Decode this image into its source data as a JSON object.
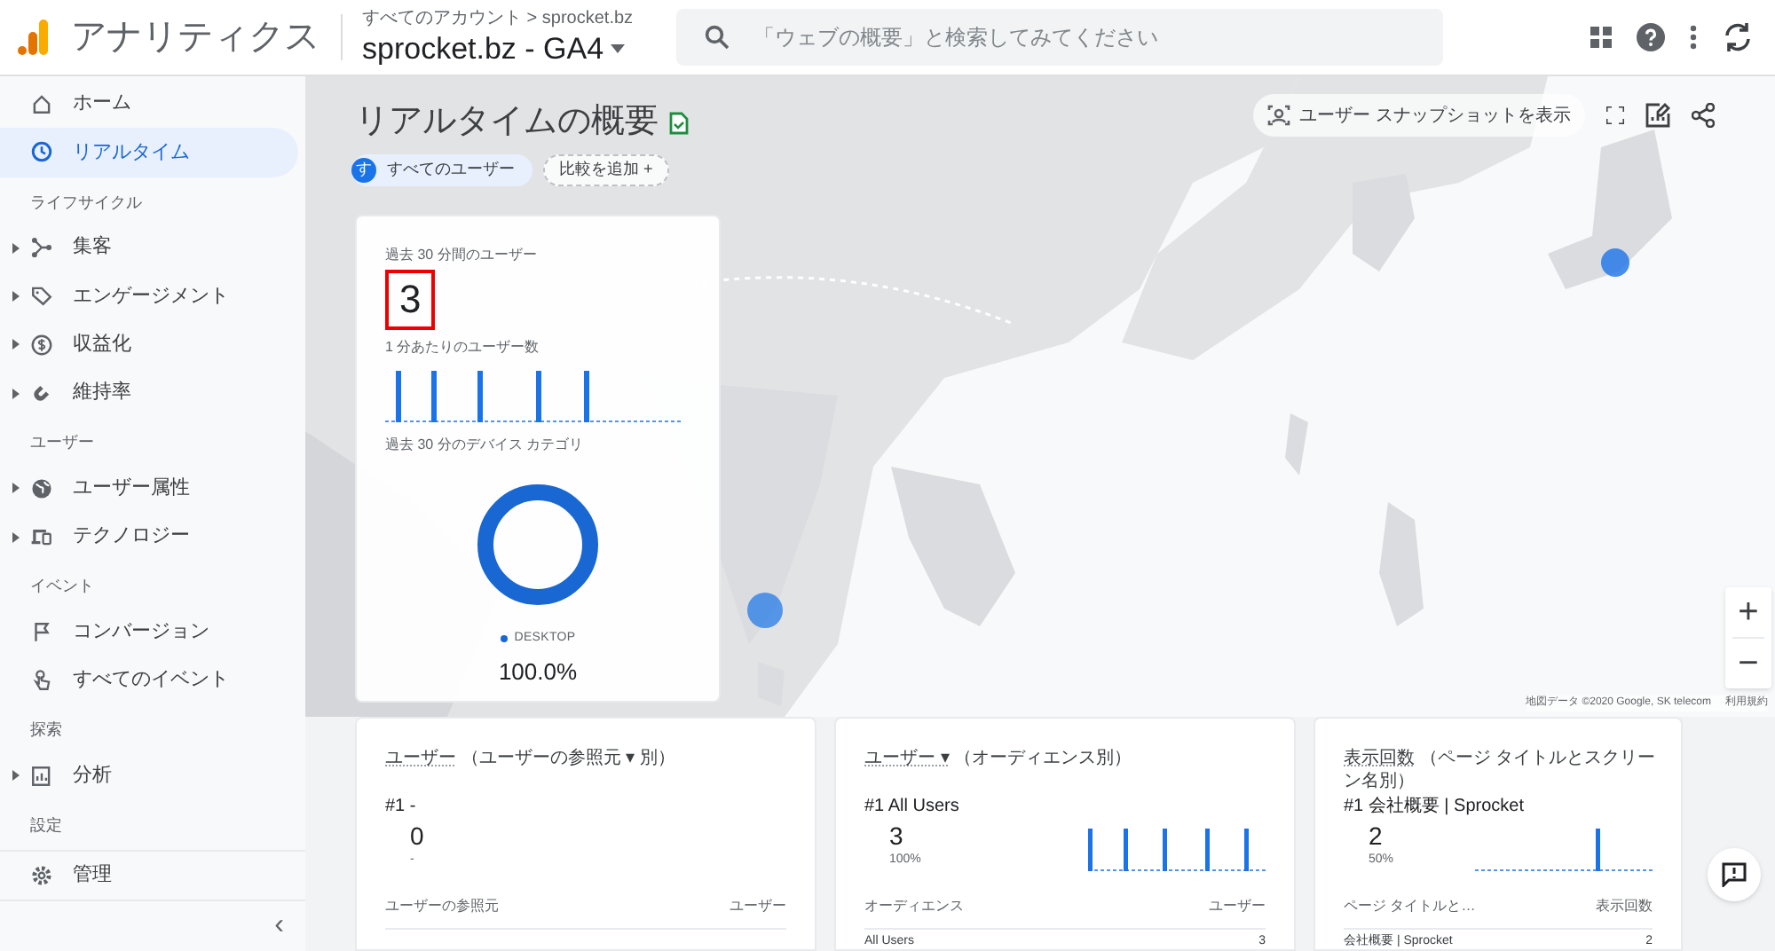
{
  "header": {
    "app_name": "アナリティクス",
    "breadcrumb": "すべてのアカウント > sprocket.bz",
    "property": "sprocket.bz - GA4",
    "search": {
      "placeholder": "「ウェブの概要」と検索してみてください"
    }
  },
  "sidebar": {
    "items": [
      {
        "kind": "item",
        "label": "ホーム",
        "selected": false,
        "expandable": false
      },
      {
        "kind": "item",
        "label": "リアルタイム",
        "selected": true,
        "expandable": false
      },
      {
        "kind": "section",
        "label": "ライフサイクル"
      },
      {
        "kind": "item",
        "label": "集客",
        "selected": false,
        "expandable": true
      },
      {
        "kind": "item",
        "label": "エンゲージメント",
        "selected": false,
        "expandable": true
      },
      {
        "kind": "item",
        "label": "収益化",
        "selected": false,
        "expandable": true
      },
      {
        "kind": "item",
        "label": "維持率",
        "selected": false,
        "expandable": true
      },
      {
        "kind": "section",
        "label": "ユーザー"
      },
      {
        "kind": "item",
        "label": "ユーザー属性",
        "selected": false,
        "expandable": true
      },
      {
        "kind": "item",
        "label": "テクノロジー",
        "selected": false,
        "expandable": true
      },
      {
        "kind": "section",
        "label": "イベント"
      },
      {
        "kind": "item",
        "label": "コンバージョン",
        "selected": false,
        "expandable": false
      },
      {
        "kind": "item",
        "label": "すべてのイベント",
        "selected": false,
        "expandable": false
      },
      {
        "kind": "section",
        "label": "探索"
      },
      {
        "kind": "item",
        "label": "分析",
        "selected": false,
        "expandable": true
      },
      {
        "kind": "section",
        "label": "設定"
      }
    ],
    "admin": {
      "label": "管理"
    },
    "collapse": "‹"
  },
  "page": {
    "title": "リアルタイムの概要",
    "segment": {
      "avatar": "す",
      "label": "すべてのユーザー"
    },
    "compare": "比較を追加 +",
    "snapshot": "ユーザー スナップショットを表示",
    "map_credit": "地図データ ©2020 Google, SK telecom",
    "map_terms": "利用規約",
    "zoom_in": "+",
    "zoom_out": "−"
  },
  "summary": {
    "users_label": "過去 30 分間のユーザー",
    "users_value": "3",
    "highlighted": true,
    "per_minute_label": "1 分あたりのユーザー数",
    "device_label": "過去 30 分のデバイス カテゴリ",
    "legend": "DESKTOP",
    "share": "100.0%"
  },
  "cards": [
    {
      "title": "ユーザー",
      "subtitle": "（ユーザーの参照元 ▾ 別）",
      "rank": "#1 -",
      "value": "0",
      "share": "-",
      "col1": "ユーザーの参照元",
      "col2": "ユーザー"
    },
    {
      "title": "ユーザー ▾",
      "subtitle": "（オーディエンス別）",
      "rank": "#1  All Users",
      "value": "3",
      "share": "100%",
      "col1": "オーディエンス",
      "col2": "ユーザー",
      "row": [
        "All Users",
        "3"
      ]
    },
    {
      "title": "表示回数",
      "subtitle": "（ページ タイトルとスクリーン名別）",
      "rank": "#1  会社概要 | Sprocket",
      "value": "2",
      "share": "50%",
      "col1": "ページ タイトルと…",
      "col2": "表示回数",
      "row": [
        "会社概要 | Sprocket",
        "2"
      ]
    }
  ]
}
